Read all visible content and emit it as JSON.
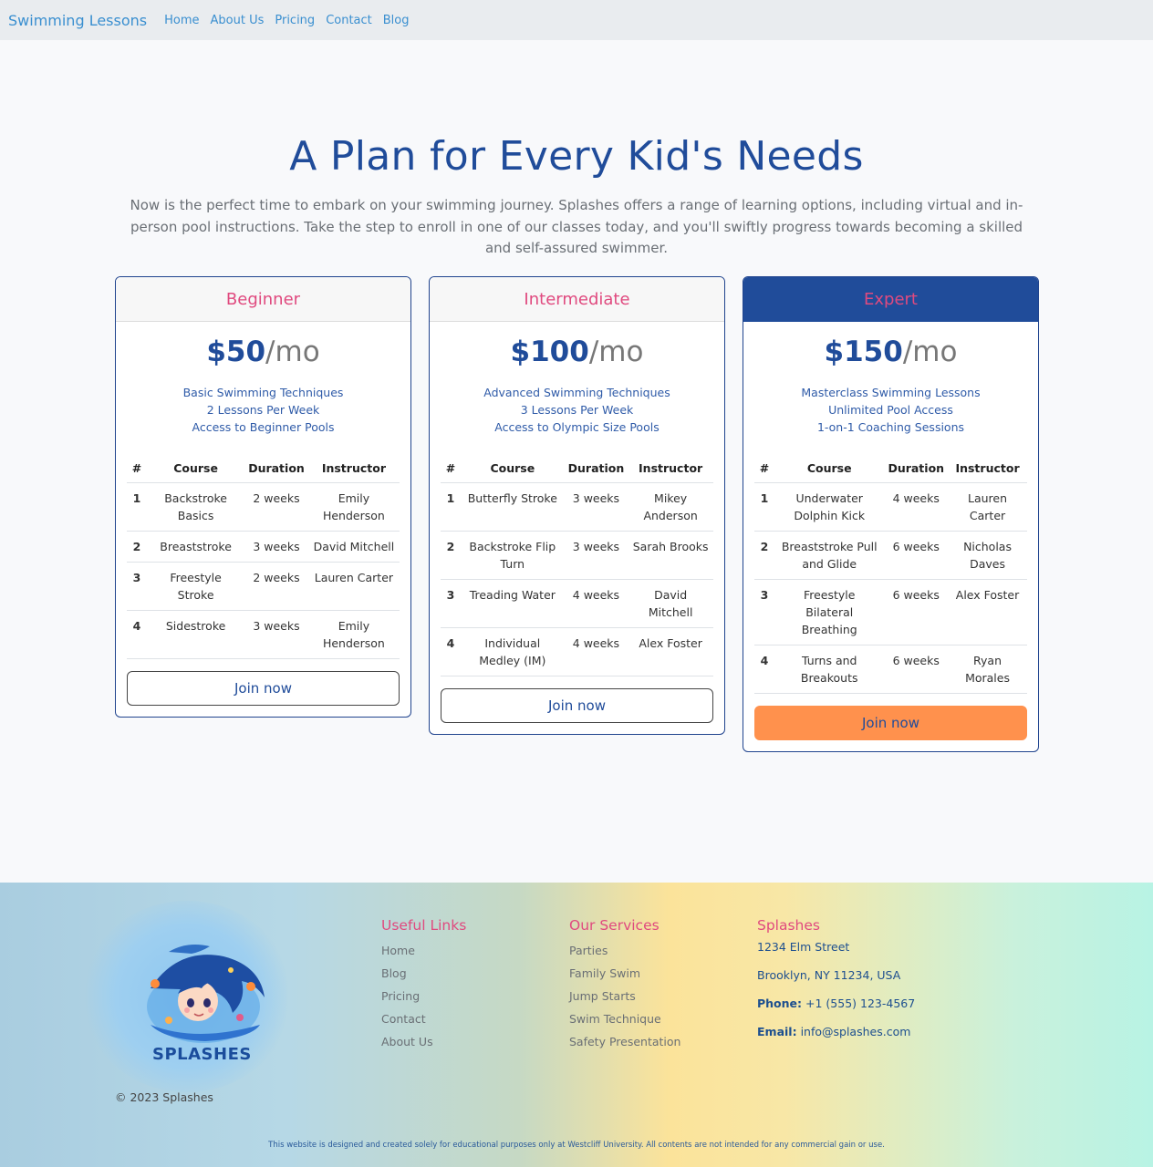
{
  "navbar": {
    "brand": "Swimming Lessons",
    "links": [
      "Home",
      "About Us",
      "Pricing",
      "Contact",
      "Blog"
    ]
  },
  "hero": {
    "title": "A Plan for Every Kid's Needs",
    "subtitle": "Now is the perfect time to embark on your swimming journey. Splashes offers a range of learning options, including virtual and in-person pool instructions. Take the step to enroll in one of our classes today, and you'll swiftly progress towards becoming a skilled and self-assured swimmer."
  },
  "plans": [
    {
      "name": "Beginner",
      "price": "$50",
      "period": "/mo",
      "features": [
        "Basic Swimming Techniques",
        "2 Lessons Per Week",
        "Access to Beginner Pools"
      ],
      "table_headers": [
        "#",
        "Course",
        "Duration",
        "Instructor"
      ],
      "rows": [
        [
          "1",
          "Backstroke Basics",
          "2 weeks",
          "Emily Henderson"
        ],
        [
          "2",
          "Breaststroke",
          "3 weeks",
          "David Mitchell"
        ],
        [
          "3",
          "Freestyle Stroke",
          "2 weeks",
          "Lauren Carter"
        ],
        [
          "4",
          "Sidestroke",
          "3 weeks",
          "Emily Henderson"
        ]
      ],
      "button": "Join now"
    },
    {
      "name": "Intermediate",
      "price": "$100",
      "period": "/mo",
      "features": [
        "Advanced Swimming Techniques",
        "3 Lessons Per Week",
        "Access to Olympic Size Pools"
      ],
      "table_headers": [
        "#",
        "Course",
        "Duration",
        "Instructor"
      ],
      "rows": [
        [
          "1",
          "Butterfly Stroke",
          "3 weeks",
          "Mikey Anderson"
        ],
        [
          "2",
          "Backstroke Flip Turn",
          "3 weeks",
          "Sarah Brooks"
        ],
        [
          "3",
          "Treading Water",
          "4 weeks",
          "David Mitchell"
        ],
        [
          "4",
          "Individual Medley (IM)",
          "4 weeks",
          "Alex Foster"
        ]
      ],
      "button": "Join now"
    },
    {
      "name": "Expert",
      "price": "$150",
      "period": "/mo",
      "features": [
        "Masterclass Swimming Lessons",
        "Unlimited Pool Access",
        "1-on-1 Coaching Sessions"
      ],
      "table_headers": [
        "#",
        "Course",
        "Duration",
        "Instructor"
      ],
      "rows": [
        [
          "1",
          "Underwater Dolphin Kick",
          "4 weeks",
          "Lauren Carter"
        ],
        [
          "2",
          "Breaststroke Pull and Glide",
          "6 weeks",
          "Nicholas Daves"
        ],
        [
          "3",
          "Freestyle Bilateral Breathing",
          "6 weeks",
          "Alex Foster"
        ],
        [
          "4",
          "Turns and Breakouts",
          "6 weeks",
          "Ryan Morales"
        ]
      ],
      "button": "Join now"
    }
  ],
  "footer": {
    "logo_text": "SPLASHES",
    "copyright": "© 2023 Splashes",
    "useful_links": {
      "title": "Useful Links",
      "items": [
        "Home",
        "Blog",
        "Pricing",
        "Contact",
        "About Us"
      ]
    },
    "services": {
      "title": "Our Services",
      "items": [
        "Parties",
        "Family Swim",
        "Jump Starts",
        "Swim Technique",
        "Safety Presentation"
      ]
    },
    "contact": {
      "title": "Splashes",
      "street": "1234 Elm Street",
      "city": "Brooklyn, NY 11234, USA",
      "phone_label": "Phone:",
      "phone": "+1 (555) 123-4567",
      "email_label": "Email:",
      "email": "info@splashes.com"
    },
    "disclaimer": "This website is designed and created solely for educational purposes only at Westcliff University. All contents are not intended for any commercial gain or use."
  },
  "colors": {
    "brand_blue": "#204c9a",
    "accent_pink": "#e04a7f",
    "button_orange": "#ff914d",
    "nav_link": "#3a8fd0"
  }
}
